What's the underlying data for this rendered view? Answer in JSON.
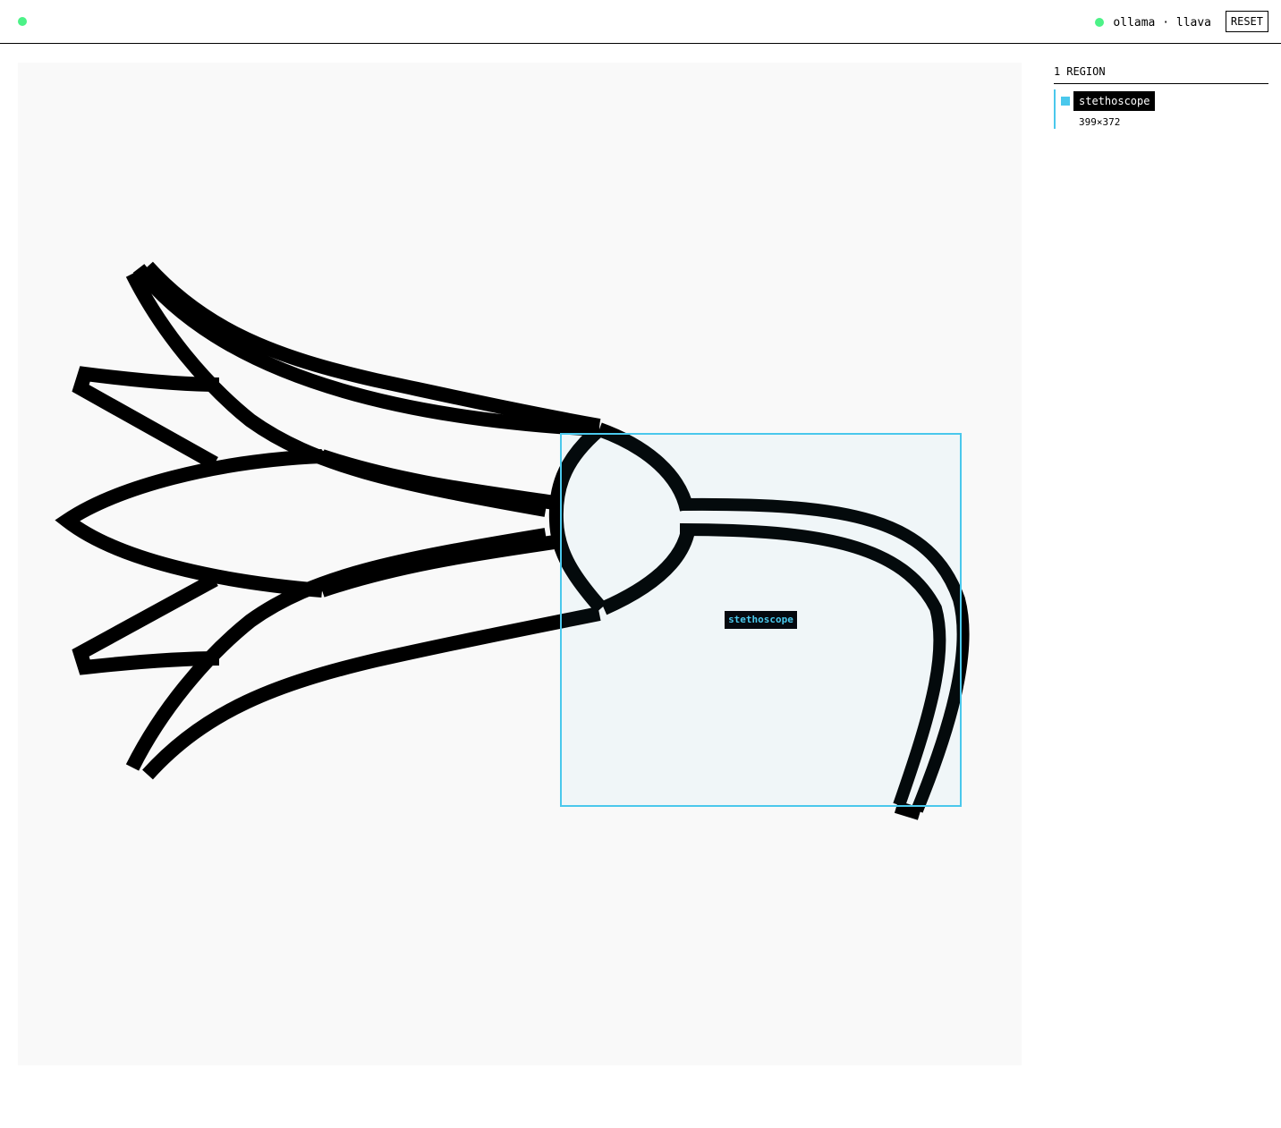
{
  "header": {
    "status_text": "ollama · llava",
    "reset_label": "RESET",
    "status_color": "#4cf287"
  },
  "panel": {
    "region_count": "1",
    "region_word": "REGION",
    "regions": [
      {
        "name": "stethoscope",
        "dims": "399×372",
        "color": "#4ac8ec"
      }
    ]
  },
  "canvas": {
    "annotation_label": "stethoscope",
    "accent_color": "#4ac8ec"
  }
}
